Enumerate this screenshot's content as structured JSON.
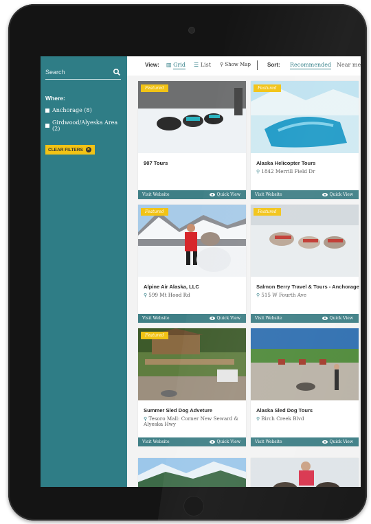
{
  "sidebar": {
    "search_placeholder": "Search",
    "where_title": "Where:",
    "filters": [
      {
        "label": "Anchorage (8)"
      },
      {
        "label": "Girdwood/Alyeska Area (2)"
      }
    ],
    "clear_filters_label": "CLEAR FILTERS"
  },
  "toolbar": {
    "view_label": "View:",
    "grid_label": "Grid",
    "list_label": "List",
    "map_label": "Show Map",
    "sort_label": "Sort:",
    "recommended_label": "Recommended",
    "near_label": "Near me"
  },
  "cards": [
    {
      "featured": "Featured",
      "title": "907 Tours",
      "address": "",
      "visit": "Visit Website",
      "quick": "Quick View"
    },
    {
      "featured": "Featured",
      "title": "Alaska Helicopter Tours",
      "address": "1842 Merrill Field Dr",
      "visit": "Visit Website",
      "quick": "Quick View"
    },
    {
      "featured": "Featured",
      "title": "Alpine Air Alaska, LLC",
      "address": "599 Mt Hood Rd",
      "visit": "Visit Website",
      "quick": "Quick View"
    },
    {
      "featured": "Featured",
      "title": "Salmon Berry Travel & Tours - Anchorage",
      "address": "515 W Fourth Ave",
      "visit": "Visit Website",
      "quick": "Quick View"
    },
    {
      "featured": "Featured",
      "title": "Summer Sled Dog Adveture",
      "address": "Tesoro Mall: Corner New Seward & Alyeska Hwy",
      "visit": "Visit Website",
      "quick": "Quick View"
    },
    {
      "featured": "",
      "title": "Alaska Sled Dog Tours",
      "address": "Birch Creek Blvd",
      "visit": "Visit Website",
      "quick": "Quick View"
    }
  ],
  "colors": {
    "teal": "#2f7d86",
    "featured_yellow": "#f2c315",
    "card_footer": "#3f7f86"
  }
}
